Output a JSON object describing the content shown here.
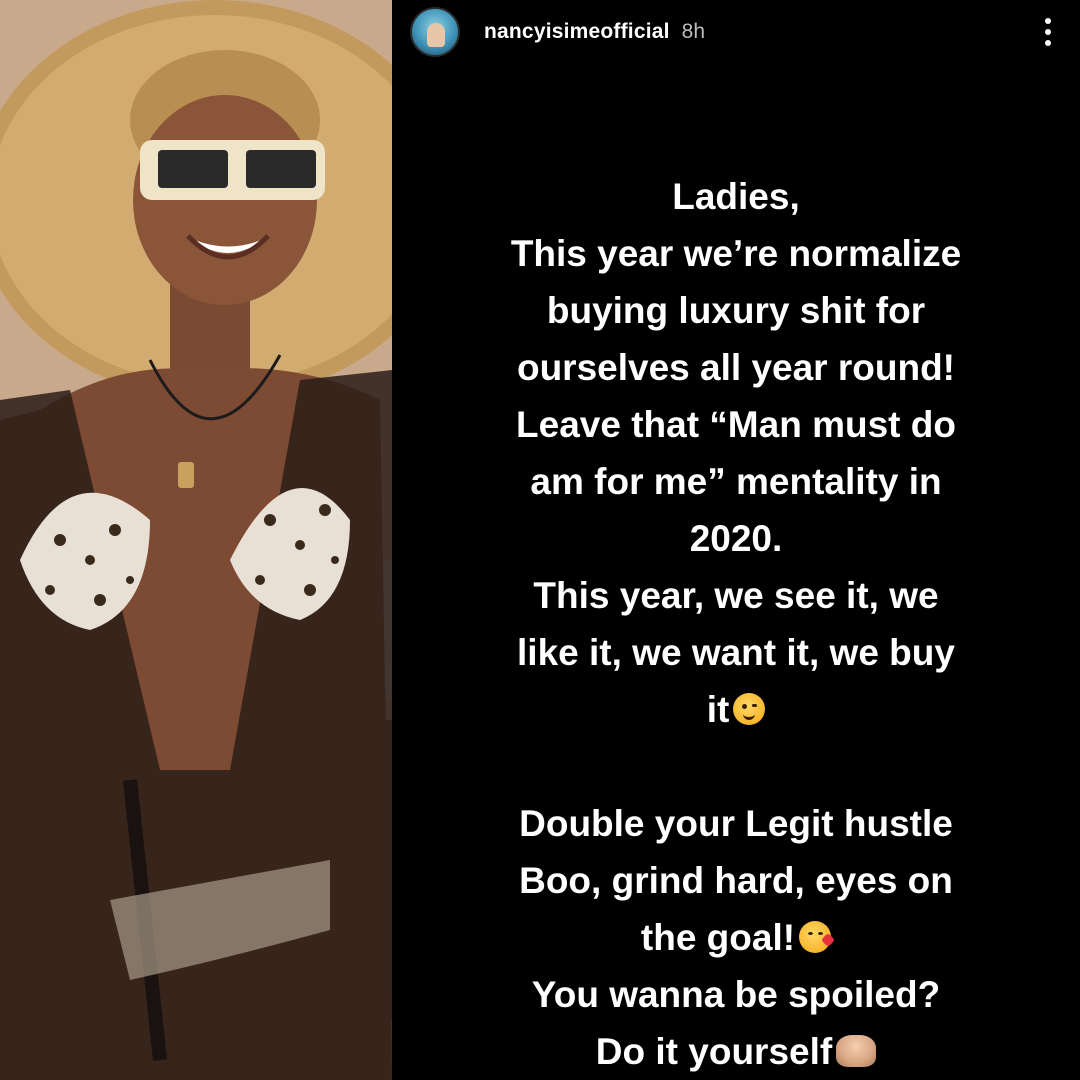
{
  "story": {
    "username": "nancyisimeofficial",
    "time": "8h",
    "lines": [
      "Ladies,",
      "This year we’re normalize",
      "buying luxury shit for",
      "ourselves all year round!",
      "Leave that “Man must do",
      "am for me” mentality in",
      "2020.",
      "This year, we see it, we",
      "like it, we want it, we buy",
      "it",
      "",
      "Double your Legit hustle",
      "Boo, grind hard, eyes on",
      "the goal!",
      "You wanna be spoiled?",
      "Do it yourself"
    ],
    "emojis": {
      "line_9": "winking-face-emoji",
      "line_13": "face-blowing-kiss-emoji",
      "line_15": "person-shrugging-emoji"
    }
  },
  "photo": {
    "subject": "photo-woman-in-sunhat"
  },
  "colors": {
    "background": "#000000",
    "text": "#ffffff",
    "muted": "#bdbdbd"
  }
}
